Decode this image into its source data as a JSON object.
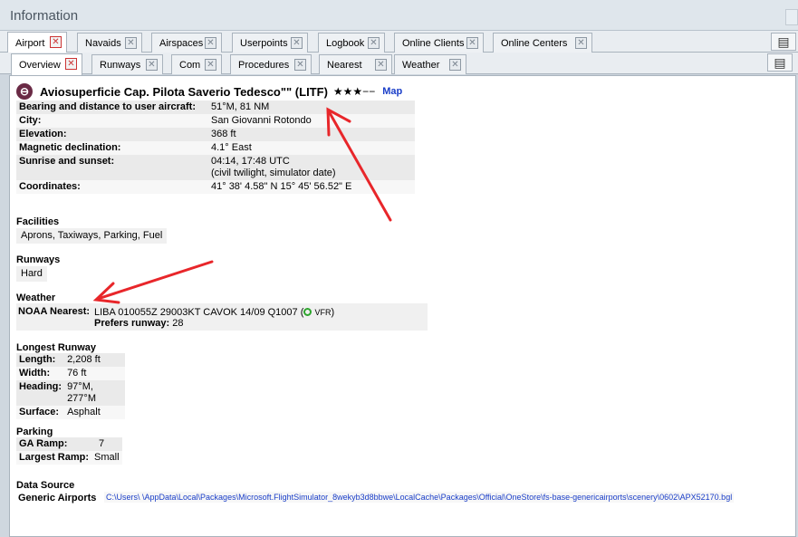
{
  "window": {
    "title": "Information"
  },
  "tabs_top": [
    {
      "label": "Airport",
      "active": true
    },
    {
      "label": "Navaids"
    },
    {
      "label": "Airspaces"
    },
    {
      "label": "Userpoints"
    },
    {
      "label": "Logbook"
    },
    {
      "label": "Online Clients"
    },
    {
      "label": "Online Centers"
    }
  ],
  "tabs_sub": [
    {
      "label": "Overview",
      "active": true
    },
    {
      "label": "Runways"
    },
    {
      "label": "Com"
    },
    {
      "label": "Procedures"
    },
    {
      "label": "Nearest"
    },
    {
      "label": "Weather"
    }
  ],
  "airport": {
    "name": "Aviosuperficie Cap. Pilota Saverio Tedesco\"\" (LITF)",
    "stars": "★★★−−",
    "map_link": "Map",
    "details": [
      {
        "key": "Bearing and distance to user aircraft:",
        "value": "51°M, 81 NM"
      },
      {
        "key": "City:",
        "value": "San Giovanni Rotondo"
      },
      {
        "key": "Elevation:",
        "value": "368 ft"
      },
      {
        "key": "Magnetic declination:",
        "value": "4.1° East"
      },
      {
        "key": "Sunrise and sunset:",
        "value": "04:14, 17:48 UTC",
        "value2": "(civil twilight, simulator date)"
      },
      {
        "key": "Coordinates:",
        "value": "41° 38' 4.58\" N 15° 45' 56.52\" E"
      }
    ]
  },
  "facilities": {
    "title": "Facilities",
    "value": "Aprons, Taxiways, Parking, Fuel"
  },
  "runways": {
    "title": "Runways",
    "value": "Hard"
  },
  "weather": {
    "title": "Weather",
    "label": "NOAA Nearest:",
    "metar": "LIBA 010055Z 29003KT CAVOK 14/09 Q1007",
    "flight_rules": "VFR",
    "prefers_label": "Prefers runway:",
    "prefers_value": "28"
  },
  "longest_runway": {
    "title": "Longest Runway",
    "rows": [
      {
        "key": "Length:",
        "value": "2,208 ft"
      },
      {
        "key": "Width:",
        "value": "76 ft"
      },
      {
        "key": "Heading:",
        "value": "97°M, 277°M"
      },
      {
        "key": "Surface:",
        "value": "Asphalt"
      }
    ]
  },
  "parking": {
    "title": "Parking",
    "rows": [
      {
        "key": "GA Ramp:",
        "value": "7"
      },
      {
        "key": "Largest Ramp:",
        "value": "Small"
      }
    ]
  },
  "data_source": {
    "title": "Data Source",
    "label": "Generic Airports",
    "path": "C:\\Users\\        \\AppData\\Local\\Packages\\Microsoft.FlightSimulator_8wekyb3d8bbwe\\LocalCache\\Packages\\Official\\OneStore\\fs-base-genericairports\\scenery\\0602\\APX52170.bgl"
  },
  "colors": {
    "link": "#1a3ec8",
    "arrow": "#e8262a",
    "vfr": "#2ea52e"
  }
}
